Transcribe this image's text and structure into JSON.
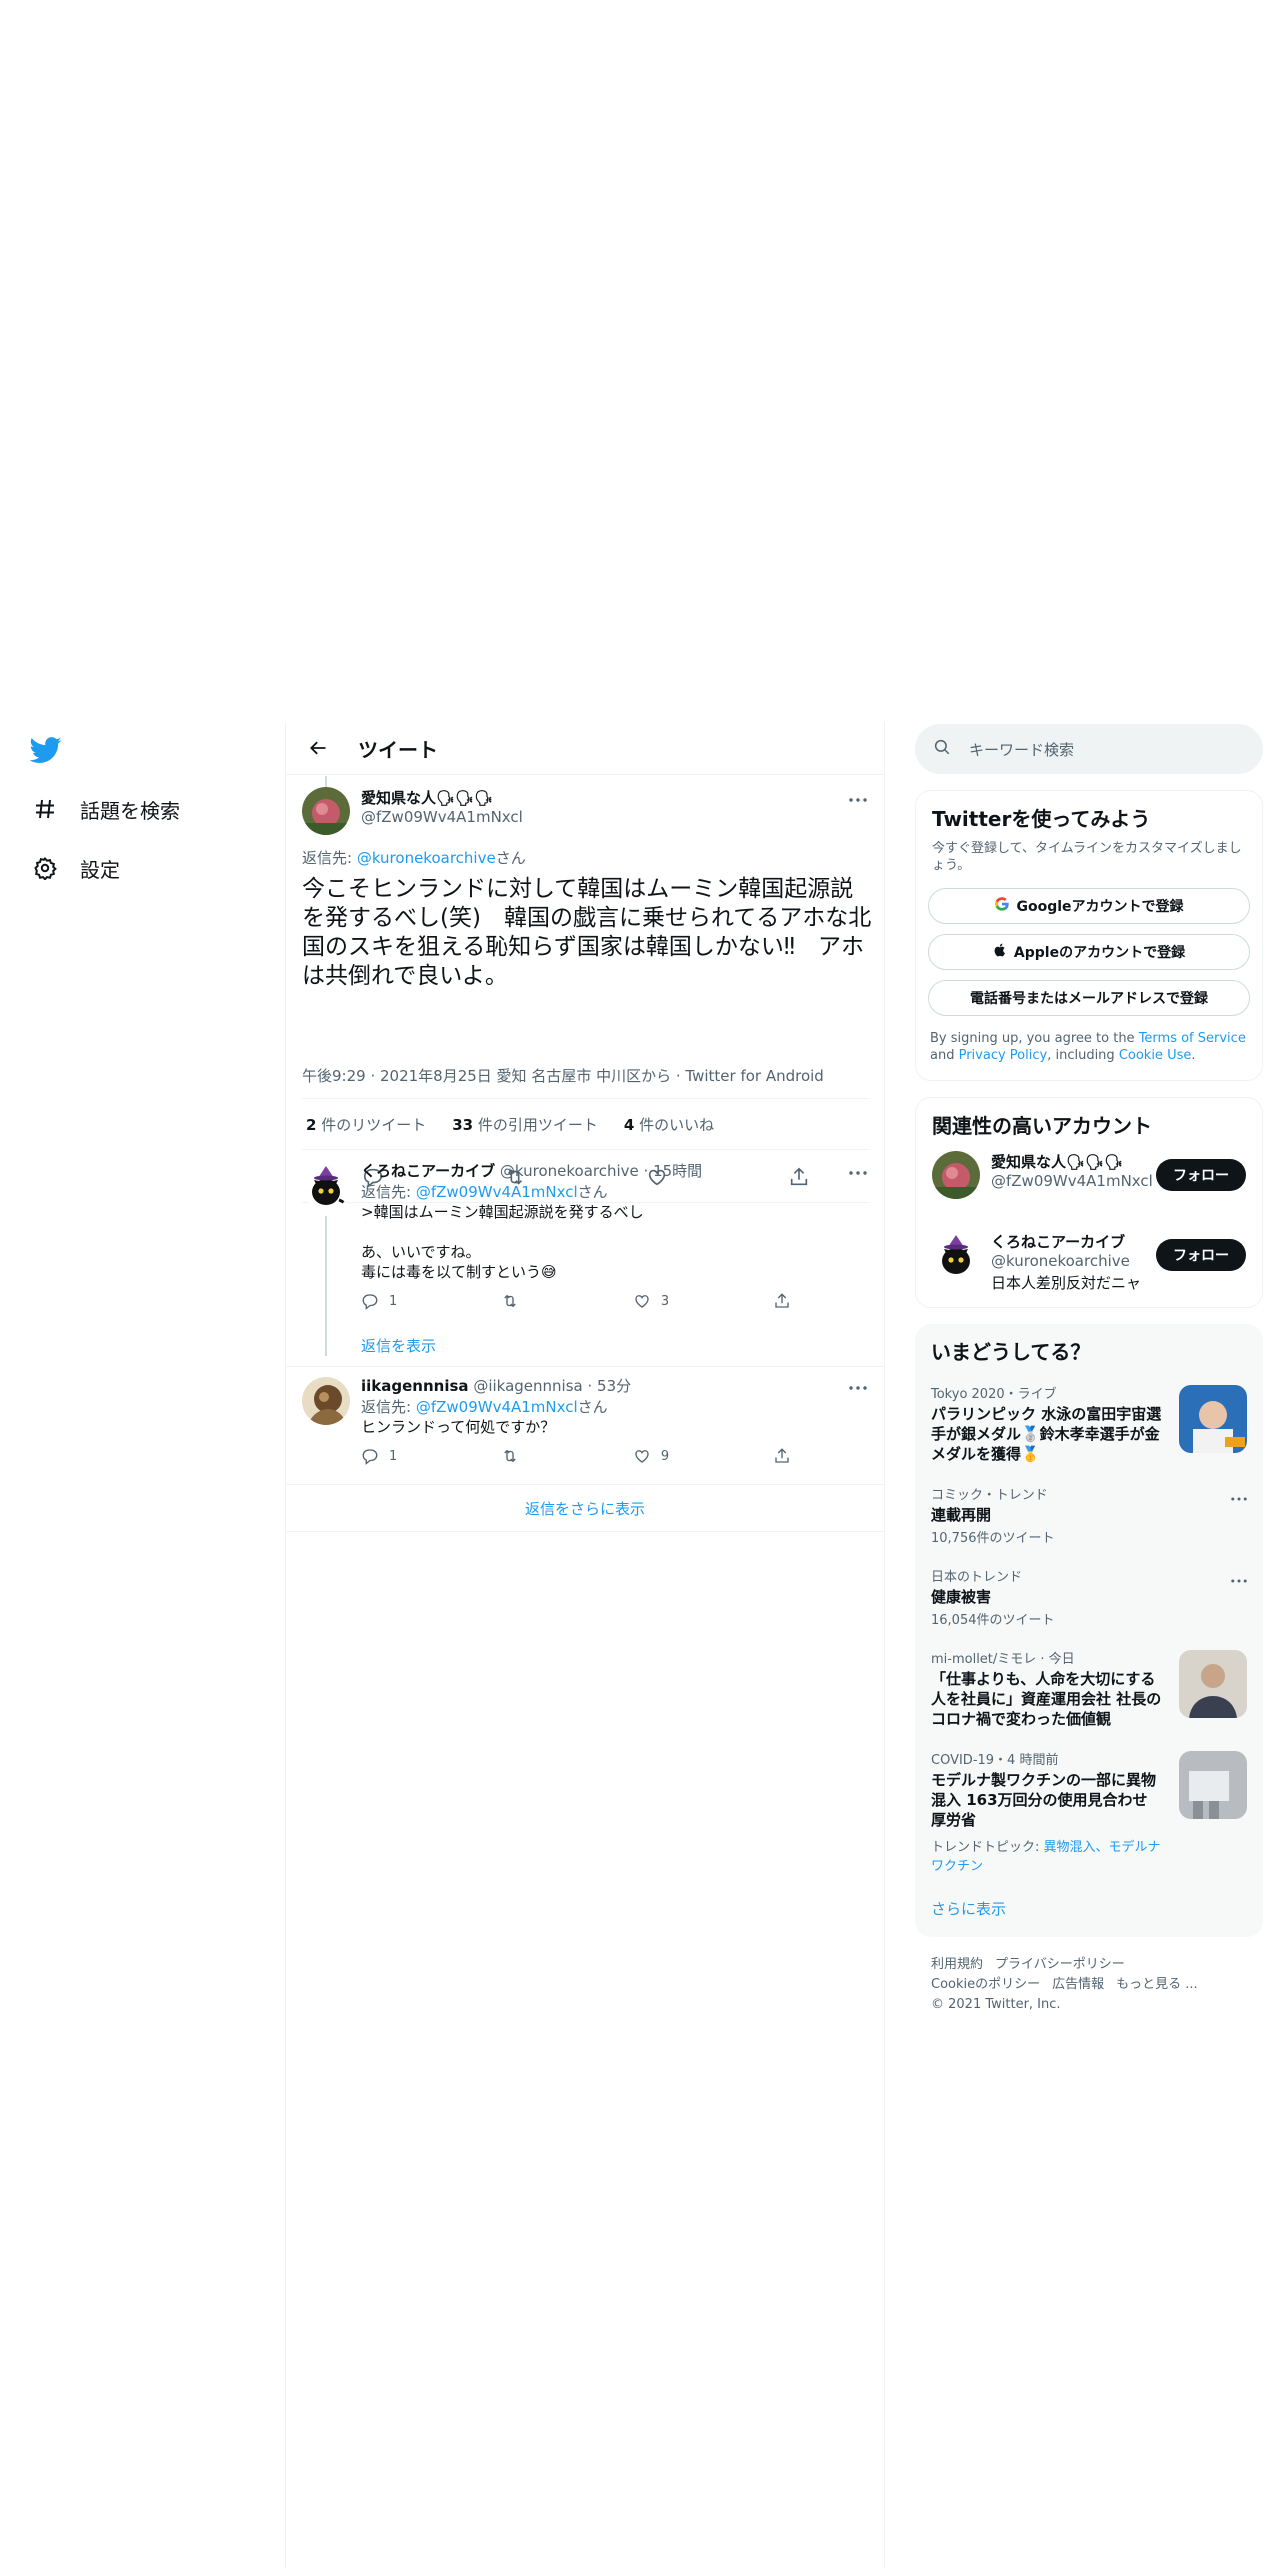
{
  "sidebar": {
    "items": [
      {
        "label": "話題を検索"
      },
      {
        "label": "設定"
      }
    ]
  },
  "header": {
    "title": "ツイート"
  },
  "focal": {
    "name": "愛知県な人🗣🗣🗣",
    "handle": "@fZw09Wv4A1mNxcl",
    "reply_prefix": "返信先: ",
    "reply_to": "@kuronekoarchive",
    "reply_suffix": "さん",
    "text": "今こそヒンランドに対して韓国はムーミン韓国起源説を発するべし(笑)　韓国の戯言に乗せられてるアホな北国のスキを狙える恥知らず国家は韓国しかない‼︎　アホは共倒れで良いよ。",
    "meta": "午後9:29 · 2021年8月25日 愛知 名古屋市 中川区から · Twitter for Android",
    "retweets_count": "2",
    "retweets_label": " 件のリツイート",
    "quotes_count": "33",
    "quotes_label": " 件の引用ツイート",
    "likes_count": "4",
    "likes_label": " 件のいいね"
  },
  "replies": [
    {
      "name": "くろねこアーカイブ",
      "handle": "@kuronekoarchive",
      "time": " · 15時間",
      "reply_prefix": "返信先: ",
      "reply_to": "@fZw09Wv4A1mNxcl",
      "reply_suffix": "さん",
      "text": ">韓国はムーミン韓国起源説を発するべし\n\nあ、いいですね。\n毒には毒を以て制すという😅",
      "reply_count": "1",
      "retweet_count": "",
      "like_count": "3",
      "show_replies": "返信を表示"
    },
    {
      "name": "iikagennnisa",
      "handle": "@iikagennnisa",
      "time": " · 53分",
      "reply_prefix": "返信先: ",
      "reply_to": "@fZw09Wv4A1mNxcl",
      "reply_suffix": "さん",
      "text": "ヒンランドって何処ですか？",
      "reply_count": "1",
      "retweet_count": "",
      "like_count": "9"
    }
  ],
  "show_more_replies": "返信をさらに表示",
  "search": {
    "placeholder": "キーワード検索"
  },
  "signup": {
    "title": "Twitterを使ってみよう",
    "subtitle": "今すぐ登録して、タイムラインをカスタマイズしましょう。",
    "google": "Googleアカウントで登録",
    "apple": "Appleのアカウントで登録",
    "phone": "電話番号またはメールアドレスで登録",
    "tos_1": "By signing up, you agree to the ",
    "tos_terms": "Terms of Service",
    "tos_2": " and ",
    "tos_privacy": "Privacy Policy",
    "tos_3": ", including ",
    "tos_cookie": "Cookie Use",
    "tos_4": "."
  },
  "related": {
    "title": "関連性の高いアカウント",
    "accounts": [
      {
        "name": "愛知県な人🗣🗣🗣",
        "handle": "@fZw09Wv4A1mNxcl",
        "bio": "",
        "follow": "フォロー"
      },
      {
        "name": "くろねこアーカイブ",
        "handle": "@kuronekoarchive",
        "bio": "日本人差別反対だニャ",
        "follow": "フォロー"
      }
    ]
  },
  "trends": {
    "title": "いまどうしてる？",
    "items": [
      {
        "context": "Tokyo 2020・ライブ",
        "title": "パラリンピック 水泳の富田宇宙選手が銀メダル🥈鈴木孝幸選手が金メダルを獲得🥇",
        "count": ""
      },
      {
        "context": "コミック・トレンド",
        "title": "連載再開",
        "count": "10,756件のツイート"
      },
      {
        "context": "日本のトレンド",
        "title": "健康被害",
        "count": "16,054件のツイート"
      },
      {
        "context": "mi-mollet/ミモレ · 今日",
        "title": "「仕事よりも、人命を大切にする人を社員に」資産運用会社 社長のコロナ禍で変わった価値観",
        "count": ""
      },
      {
        "context": "COVID-19・4 時間前",
        "title": "モデルナ製ワクチンの一部に異物混入 163万回分の使用見合わせ 厚労省",
        "count": "",
        "topics_label": "トレンドトピック: ",
        "topics": "異物混入、モデルナワクチン"
      }
    ],
    "show_more": "さらに表示"
  },
  "footer": {
    "links": [
      "利用規約",
      "プライバシーポリシー",
      "Cookieのポリシー",
      "広告情報",
      "もっと見る ..."
    ],
    "copyright": "© 2021 Twitter, Inc."
  },
  "colors": {
    "accent": "#1d9bf0",
    "text": "#0f1419",
    "muted": "#536471",
    "border": "#eff3f4"
  }
}
